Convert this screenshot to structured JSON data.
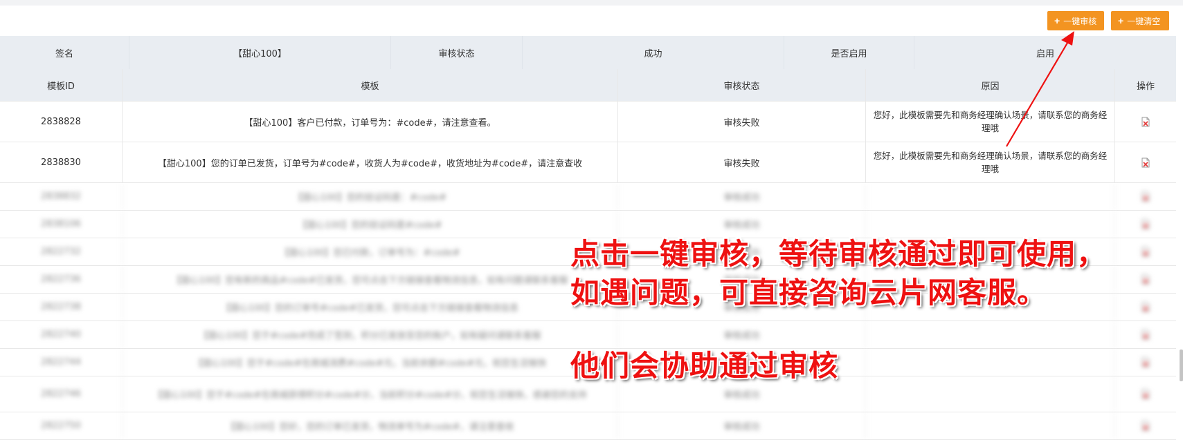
{
  "toolbar": {
    "audit_all_label": "一键审核",
    "clear_all_label": "一键清空",
    "button_color": "#f39421"
  },
  "signature": {
    "label_sign": "签名",
    "sign_value": "【甜心100】",
    "label_status": "审核状态",
    "status_value": "成功",
    "label_enabled": "是否启用",
    "enabled_value": "启用"
  },
  "table": {
    "headers": [
      "模板ID",
      "模板",
      "审核状态",
      "原因",
      "操作"
    ],
    "rows": [
      {
        "id": "2838828",
        "template": "【甜心100】客户已付款，订单号为：#code#，请注意查看。",
        "status": "审核失败",
        "reason": "您好，此模板需要先和商务经理确认场景，请联系您的商务经理哦"
      },
      {
        "id": "2838830",
        "template": "【甜心100】您的订单已发货，订单号为#code#，收货人为#code#，收货地址为#code#，请注意查收",
        "status": "审核失败",
        "reason": "您好，此模板需要先和商务经理确认场景，请联系您的商务经理哦"
      }
    ],
    "blurred_rows": [
      {
        "id": "2838832",
        "template": "【甜心100】您的验证码是：#code#",
        "status": "审核成功"
      },
      {
        "id": "2838106",
        "template": "【甜心100】您的验证码是#code#",
        "status": "审核成功"
      },
      {
        "id": "2822732",
        "template": "【甜心100】您已付款，订单号为：#code#",
        "status": "审核成功"
      },
      {
        "id": "2822736",
        "template": "【甜心100】您有新的商品#code#已发货，您可点击下方链接查看物流信息，如有问题请联系客服",
        "status": "审核成功"
      },
      {
        "id": "2822738",
        "template": "【甜心100】您的订单号#code#已发货，您可点击下方链接查看物流信息",
        "status": "审核成功"
      },
      {
        "id": "2822740",
        "template": "【甜心100】您于#code#完成了签到，积分已发放至您的账户，如有疑问请联系客服",
        "status": "审核成功"
      },
      {
        "id": "2822744",
        "template": "【甜心100】您于#code#在商城消费#code#元，当前余额#code#元，祝您生活愉快",
        "status": "审核成功"
      },
      {
        "id": "2822746",
        "template": "【甜心100】您于#code#在商城获得积分#code#分，当前积分#code#分，祝您生活愉快，感谢您的支持",
        "status": "审核成功"
      },
      {
        "id": "2822750",
        "template": "【甜心100】您好，您的订单已发货，物流单号为#code#，请注意查收",
        "status": "审核成功"
      }
    ]
  },
  "annotation": {
    "line1": "点击一键审核，等待审核通过即可使用，",
    "line2": "如遇问题，可直接咨询云片网客服。",
    "line3": "他们会协助通过审核",
    "color": "#ee1111"
  },
  "icons": {
    "delete": "delete-file-icon",
    "plus": "plus-icon",
    "arrow": "red-arrow-annotation"
  }
}
